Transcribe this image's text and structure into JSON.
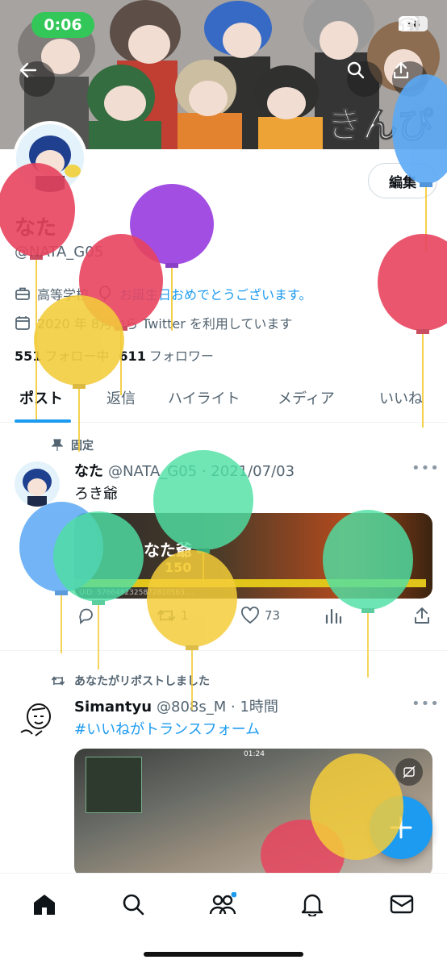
{
  "status": {
    "time": "0:06",
    "battery": "36"
  },
  "profile": {
    "name": "なた",
    "handle": "@NATA_G05",
    "edit_label": "編集",
    "bio_school": "高等学校",
    "bio_text": "お誕生日おめでとうございます。",
    "joined": "2020 年 8月から Twitter を利用しています",
    "following_count": "551",
    "following_label": "フォロー中",
    "followers_count": "611",
    "followers_label": "フォロワー"
  },
  "tabs": [
    "ポスト",
    "返信",
    "ハイライト",
    "メディア",
    "いいね"
  ],
  "post1": {
    "pinned_label": "固定",
    "name": "なた",
    "meta": "@NATA_G05 · 2021/07/03",
    "text": "ろき爺",
    "media_name": "なた爺",
    "media_score": "150",
    "media_id": "UID: 5766482325872810563 ...",
    "replies": "",
    "reposts": "1",
    "likes": "73"
  },
  "post2": {
    "repost_label": "あなたがリポストしました",
    "name": "Simantyu",
    "meta": "@808s_M · 1時間",
    "text": "#いいねがトランスフォーム",
    "media_time": "01:24"
  },
  "colors": {
    "accent": "#1d9bf0",
    "balloon_red": "#e8445e",
    "balloon_yellow": "#f3cc3a",
    "balloon_green": "#4fe0a4",
    "balloon_blue": "#5aa8f5",
    "balloon_purple": "#9b3fe0"
  }
}
